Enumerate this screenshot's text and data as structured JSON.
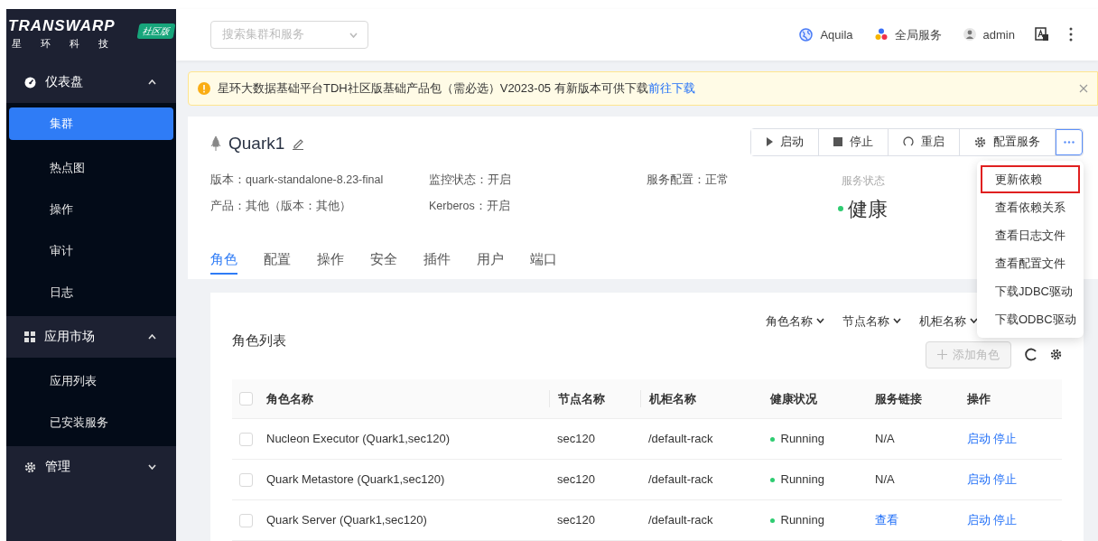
{
  "logo": {
    "wordmark": "TRANSWARP",
    "subtitle": "星 环 科 技",
    "badge": "社区版"
  },
  "sidebar": {
    "sections": [
      {
        "label": "仪表盘",
        "kind": "gauge",
        "expanded": true,
        "children": [
          {
            "label": "集群",
            "selected": true
          },
          {
            "label": "热点图",
            "selected": false
          },
          {
            "label": "操作",
            "selected": false
          },
          {
            "label": "审计",
            "selected": false
          },
          {
            "label": "日志",
            "selected": false
          }
        ]
      },
      {
        "label": "应用市场",
        "kind": "grid",
        "expanded": true,
        "children": [
          {
            "label": "应用列表",
            "selected": false
          },
          {
            "label": "已安装服务",
            "selected": false
          }
        ]
      },
      {
        "label": "管理",
        "kind": "gear",
        "expanded": false
      }
    ]
  },
  "header": {
    "search": {
      "placeholder": "搜索集群和服务"
    },
    "links": [
      {
        "label": "Aquila",
        "kind": "globe"
      },
      {
        "label": "全局服务",
        "kind": "dots"
      },
      {
        "label": "admin",
        "kind": "user"
      }
    ]
  },
  "alert": {
    "text": "星环大数据基础平台TDH社区版基础产品包（需必选）V2023-05 有新版本可供下载",
    "link": "前往下载"
  },
  "service": {
    "name": "Quark1",
    "actions": [
      {
        "label": "启动",
        "kind": "play"
      },
      {
        "label": "停止",
        "kind": "stop"
      },
      {
        "label": "重启",
        "kind": "restart"
      },
      {
        "label": "配置服务",
        "kind": "gear"
      }
    ],
    "info": [
      [
        "版本：quark-standalone-8.23-final",
        "监控状态：开启",
        "服务配置：正常"
      ],
      [
        "产品：其他（版本：其他）",
        "Kerberos：开启"
      ]
    ],
    "status": {
      "label": "服务状态",
      "value": "健康"
    },
    "tabs": [
      {
        "label": "角色",
        "selected": true
      },
      {
        "label": "配置",
        "selected": false
      },
      {
        "label": "操作",
        "selected": false
      },
      {
        "label": "安全",
        "selected": false
      },
      {
        "label": "插件",
        "selected": false
      },
      {
        "label": "用户",
        "selected": false
      },
      {
        "label": "端口",
        "selected": false
      }
    ]
  },
  "menu": {
    "items": [
      {
        "label": "更新依赖",
        "highlighted": true
      },
      {
        "label": "查看依赖关系",
        "highlighted": false
      },
      {
        "label": "查看日志文件",
        "highlighted": false
      },
      {
        "label": "查看配置文件",
        "highlighted": false
      },
      {
        "label": "下载JDBC驱动",
        "highlighted": false
      },
      {
        "label": "下载ODBC驱动",
        "highlighted": false
      }
    ]
  },
  "roles": {
    "title": "角色列表",
    "filters": [
      "角色名称",
      "节点名称",
      "机柜名称"
    ],
    "add_button": {
      "label": "添加角色",
      "disabled": true
    },
    "select_all_checked": false,
    "columns": [
      "角色名称",
      "节点名称",
      "机柜名称",
      "健康状况",
      "服务链接",
      "操作"
    ],
    "rows": [
      {
        "checked": false,
        "name": "Nucleon Executor (Quark1,sec120)",
        "node": "sec120",
        "rack": "/default-rack",
        "health": "Running",
        "link": {
          "text": "N/A",
          "kind": "text"
        },
        "actions": [
          "启动",
          "停止"
        ]
      },
      {
        "checked": false,
        "name": "Quark Metastore (Quark1,sec120)",
        "node": "sec120",
        "rack": "/default-rack",
        "health": "Running",
        "link": {
          "text": "N/A",
          "kind": "text"
        },
        "actions": [
          "启动",
          "停止"
        ]
      },
      {
        "checked": false,
        "name": "Quark Server (Quark1,sec120)",
        "node": "sec120",
        "rack": "/default-rack",
        "health": "Running",
        "link": {
          "text": "查看",
          "kind": "link"
        },
        "actions": [
          "启动",
          "停止"
        ]
      }
    ]
  }
}
